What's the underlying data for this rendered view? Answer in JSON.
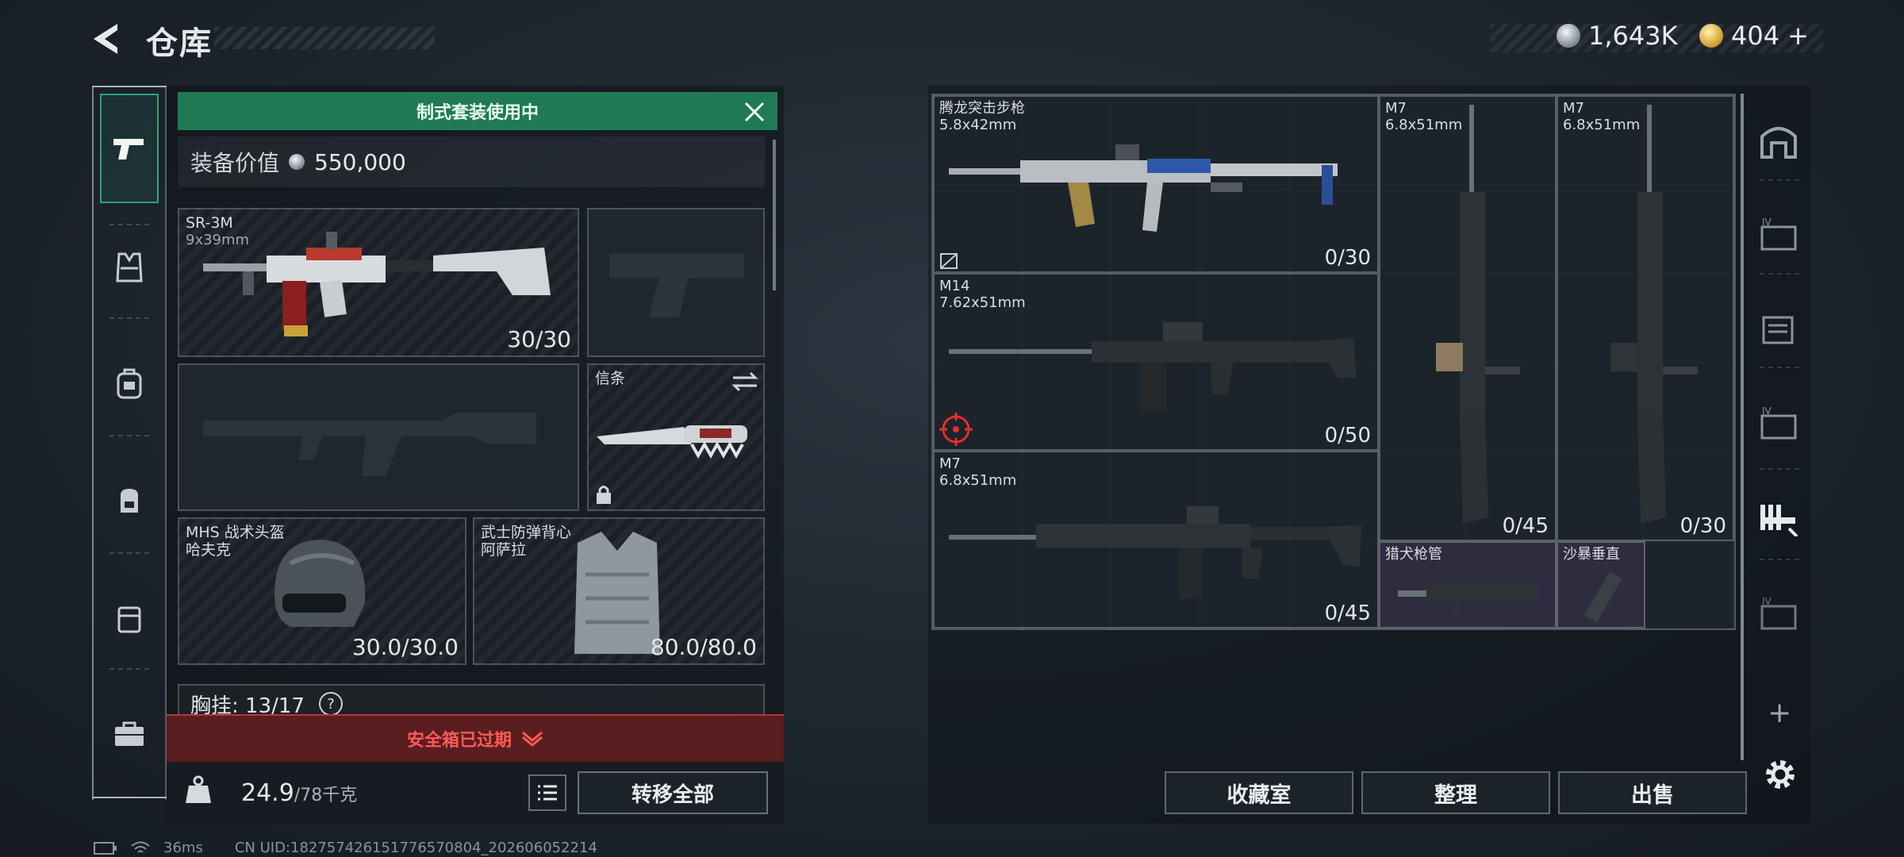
{
  "header": {
    "title": "仓库",
    "currency": [
      {
        "icon": "silver-coin-icon",
        "value": "1,643K"
      },
      {
        "icon": "gold-coin-icon",
        "value": "404"
      }
    ],
    "add_symbol": "+"
  },
  "loadout": {
    "banner": "制式套装使用中",
    "value_label": "装备价值",
    "value": "550,000",
    "primary": {
      "name": "SR-3M",
      "caliber": "9x39mm",
      "ammo": "30/30"
    },
    "melee": {
      "name": "信条"
    },
    "helmet": {
      "name": "MHS 战术头盔",
      "sub": "哈夫克",
      "durability": "30.0/30.0"
    },
    "armor": {
      "name": "武士防弹背心",
      "sub": "阿萨拉",
      "durability": "80.0/80.0"
    },
    "chest_rig": {
      "label": "胸挂:",
      "value": "13/17",
      "help": "?"
    },
    "safe_box": "安全箱已过期",
    "weight": {
      "value": "24.9",
      "max": "/78千克"
    },
    "transfer_all": "转移全部"
  },
  "storage": {
    "items": [
      {
        "name": "腾龙突击步枪",
        "caliber": "5.8x42mm",
        "ammo": "0/30"
      },
      {
        "name": "M14",
        "caliber": "7.62x51mm",
        "ammo": "0/50"
      },
      {
        "name": "M7",
        "caliber": "6.8x51mm",
        "ammo": "0/45"
      },
      {
        "name": "M7",
        "caliber": "6.8x51mm",
        "ammo": "0/45"
      },
      {
        "name": "M7",
        "caliber": "6.8x51mm",
        "ammo": "0/30"
      },
      {
        "name": "猎犬枪管",
        "caliber": "",
        "ammo": ""
      },
      {
        "name": "沙暴垂直",
        "caliber": "",
        "ammo": ""
      }
    ],
    "buttons": {
      "collection": "收藏室",
      "sort": "整理",
      "sell": "出售"
    },
    "add": "+"
  },
  "status": {
    "ping": "36ms",
    "uid": "CN UID:182757426151776570804_202606052214"
  },
  "colors": {
    "accent_green": "#1f7a55",
    "warning_red": "#ff5a55",
    "purple_item": "#2f2c40"
  }
}
